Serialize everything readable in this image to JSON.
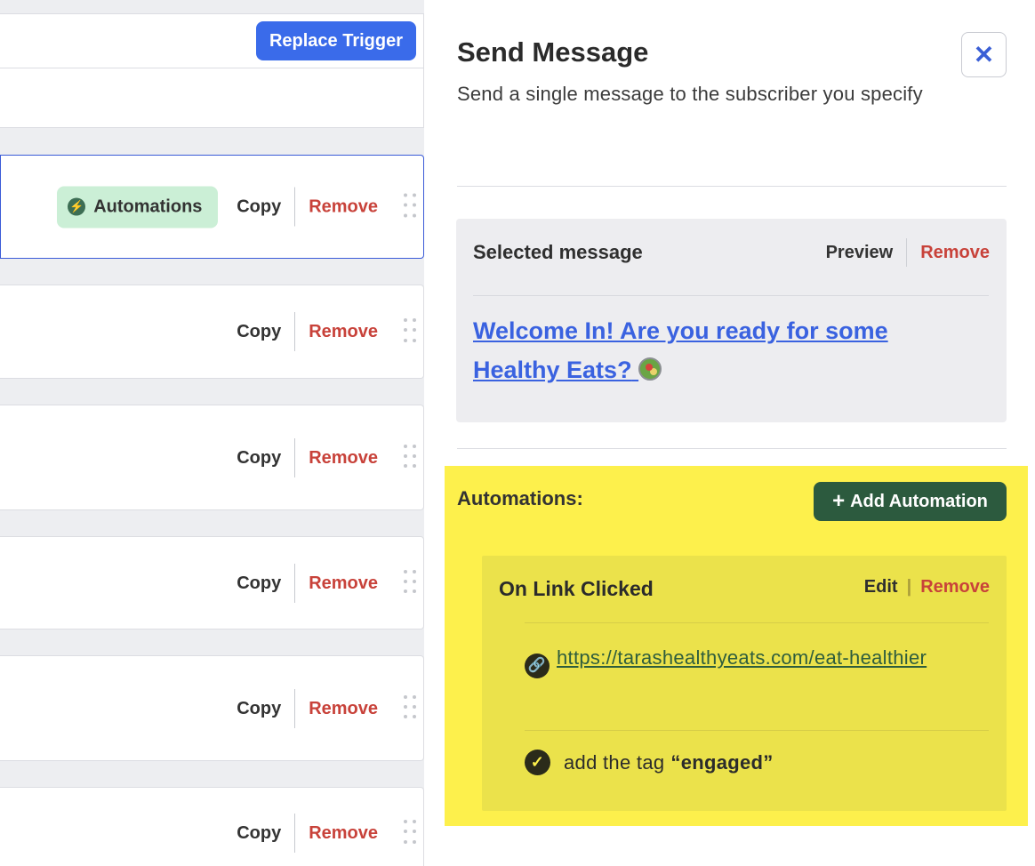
{
  "workflow": {
    "replace_trigger_label": "Replace Trigger",
    "steps": [
      {
        "has_automation_badge": true,
        "badge_label": "Automations",
        "copy": "Copy",
        "remove": "Remove"
      },
      {
        "has_automation_badge": false,
        "copy": "Copy",
        "remove": "Remove"
      },
      {
        "has_automation_badge": false,
        "copy": "Copy",
        "remove": "Remove"
      },
      {
        "has_automation_badge": false,
        "copy": "Copy",
        "remove": "Remove"
      },
      {
        "has_automation_badge": false,
        "copy": "Copy",
        "remove": "Remove"
      },
      {
        "has_automation_badge": false,
        "copy": "Copy",
        "remove": "Remove"
      }
    ]
  },
  "panel": {
    "title": "Send Message",
    "subtitle": "Send a single message to the subscriber you specify",
    "close_label": "✕",
    "selected_message": {
      "label": "Selected message",
      "preview": "Preview",
      "remove": "Remove",
      "message_title": "Welcome In! Are you ready for some Healthy Eats?"
    },
    "automations": {
      "label": "Automations:",
      "add_button": "Add Automation",
      "card": {
        "title": "On Link Clicked",
        "edit": "Edit",
        "separator": "|",
        "remove": "Remove",
        "url": "https://tarashealthyeats.com/eat-healthier",
        "action_prefix": "add the tag",
        "tag": "“engaged”"
      }
    }
  },
  "colors": {
    "primary_blue": "#3a6bea",
    "remove_red": "#c8423a",
    "automation_green": "#2c5a3e",
    "highlight_yellow": "#fdf04c",
    "badge_green": "#cbefd6"
  }
}
